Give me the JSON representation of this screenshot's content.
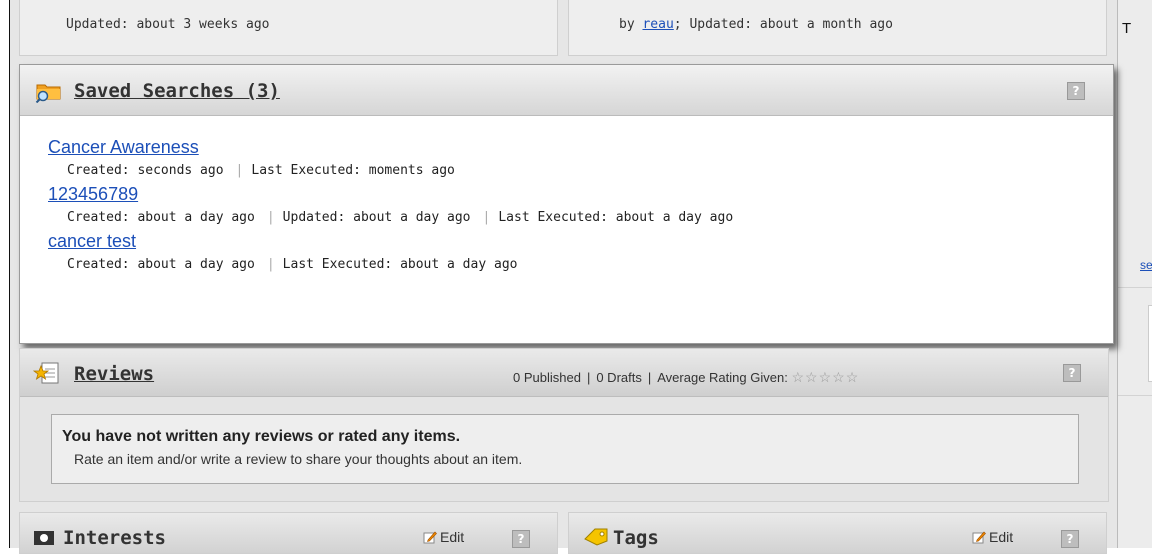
{
  "top": {
    "left_meta": "Updated: about 3 weeks ago",
    "right_by": "by ",
    "right_author": "reau",
    "right_meta": "; Updated: about a month ago"
  },
  "right_panel": {
    "title_fragment": "T",
    "link_fragment": "se"
  },
  "saved_searches": {
    "title": "Saved Searches (3)",
    "help": "?",
    "items": [
      {
        "name": "Cancer Awareness",
        "meta": [
          "Created: seconds ago",
          "Last Executed: moments ago"
        ]
      },
      {
        "name": "123456789",
        "meta": [
          "Created: about a day ago",
          "Updated: about a day ago",
          "Last Executed: about a day ago"
        ]
      },
      {
        "name": "cancer test",
        "meta": [
          "Created: about a day ago",
          "Last Executed: about a day ago"
        ]
      }
    ]
  },
  "reviews": {
    "title": "Reviews",
    "published": "0 Published",
    "drafts": "0 Drafts",
    "avg_label": "Average Rating Given:",
    "avg_rating": 0,
    "max_rating": 5,
    "help": "?",
    "empty_heading": "You have not written any reviews or rated any items.",
    "empty_sub": "Rate an item and/or write a review to share your thoughts about an item."
  },
  "interests": {
    "title": "Interests",
    "edit": "Edit",
    "help": "?"
  },
  "tags": {
    "title": "Tags",
    "edit": "Edit",
    "help": "?"
  },
  "colors": {
    "link": "#1c4fb8",
    "background": "#e6e6e6"
  }
}
